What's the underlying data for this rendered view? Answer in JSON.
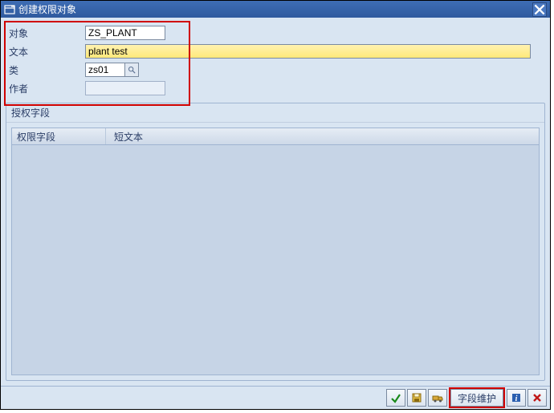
{
  "window": {
    "title": "创建权限对象",
    "close_tooltip": "关闭"
  },
  "form": {
    "object_label": "对象",
    "object_value": "ZS_PLANT",
    "text_label": "文本",
    "text_value": "plant test",
    "class_label": "类",
    "class_value": "zs01",
    "author_label": "作者",
    "author_value": ""
  },
  "group": {
    "title": "授权字段",
    "col_field": "权限字段",
    "col_shorttext": "短文本"
  },
  "footer": {
    "field_maint": "字段维护"
  }
}
